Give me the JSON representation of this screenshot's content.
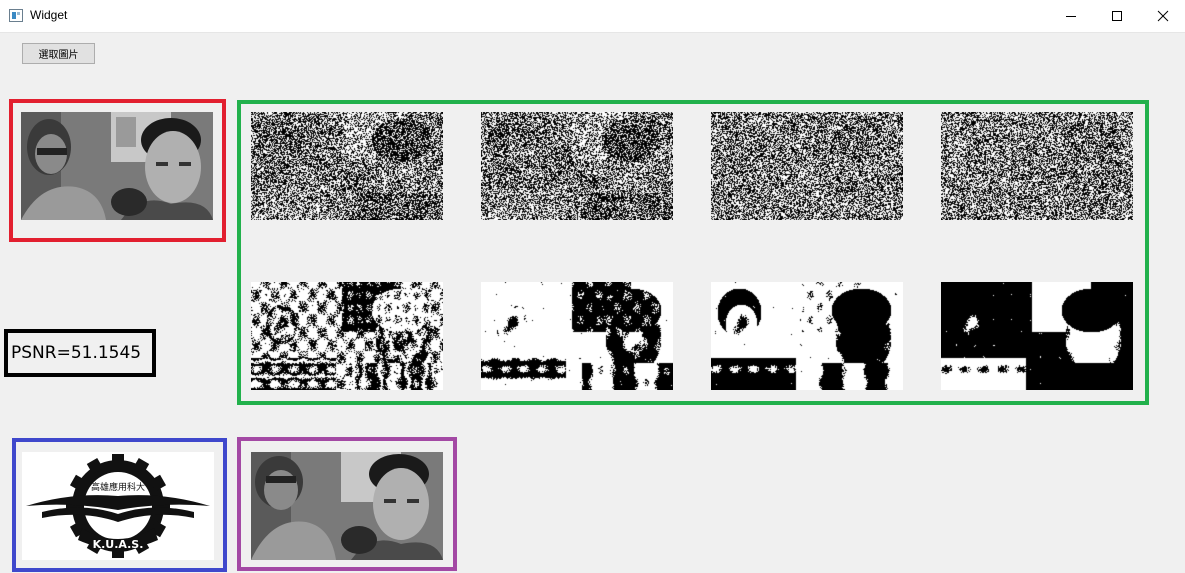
{
  "window": {
    "title": "Widget",
    "controls": {
      "minimize_icon": "minimize-icon",
      "maximize_icon": "maximize-icon",
      "close_icon": "close-icon"
    }
  },
  "toolbar": {
    "select_image_label": "選取圖片"
  },
  "images": {
    "original": "grayscale photo of two people",
    "bit_planes": [
      {
        "plane": 1,
        "style": "noise"
      },
      {
        "plane": 2,
        "style": "noise"
      },
      {
        "plane": 3,
        "style": "noise-with-shapes"
      },
      {
        "plane": 4,
        "style": "noise-with-shapes"
      },
      {
        "plane": 5,
        "style": "contour"
      },
      {
        "plane": 6,
        "style": "contour"
      },
      {
        "plane": 7,
        "style": "silhouette"
      },
      {
        "plane": 8,
        "style": "silhouette-dark"
      }
    ],
    "watermark_logo": {
      "text": "高雄應用科大",
      "sub": "K.U.A.S."
    },
    "result": "grayscale photo of two people (watermarked)"
  },
  "metrics": {
    "psnr_text": "PSNR=51.1545"
  },
  "colors": {
    "original_frame": "#e21f2f",
    "bit_planes_frame": "#22b14c",
    "psnr_frame": "#000000",
    "watermark_frame": "#3f48cc",
    "result_frame": "#a349a4"
  }
}
